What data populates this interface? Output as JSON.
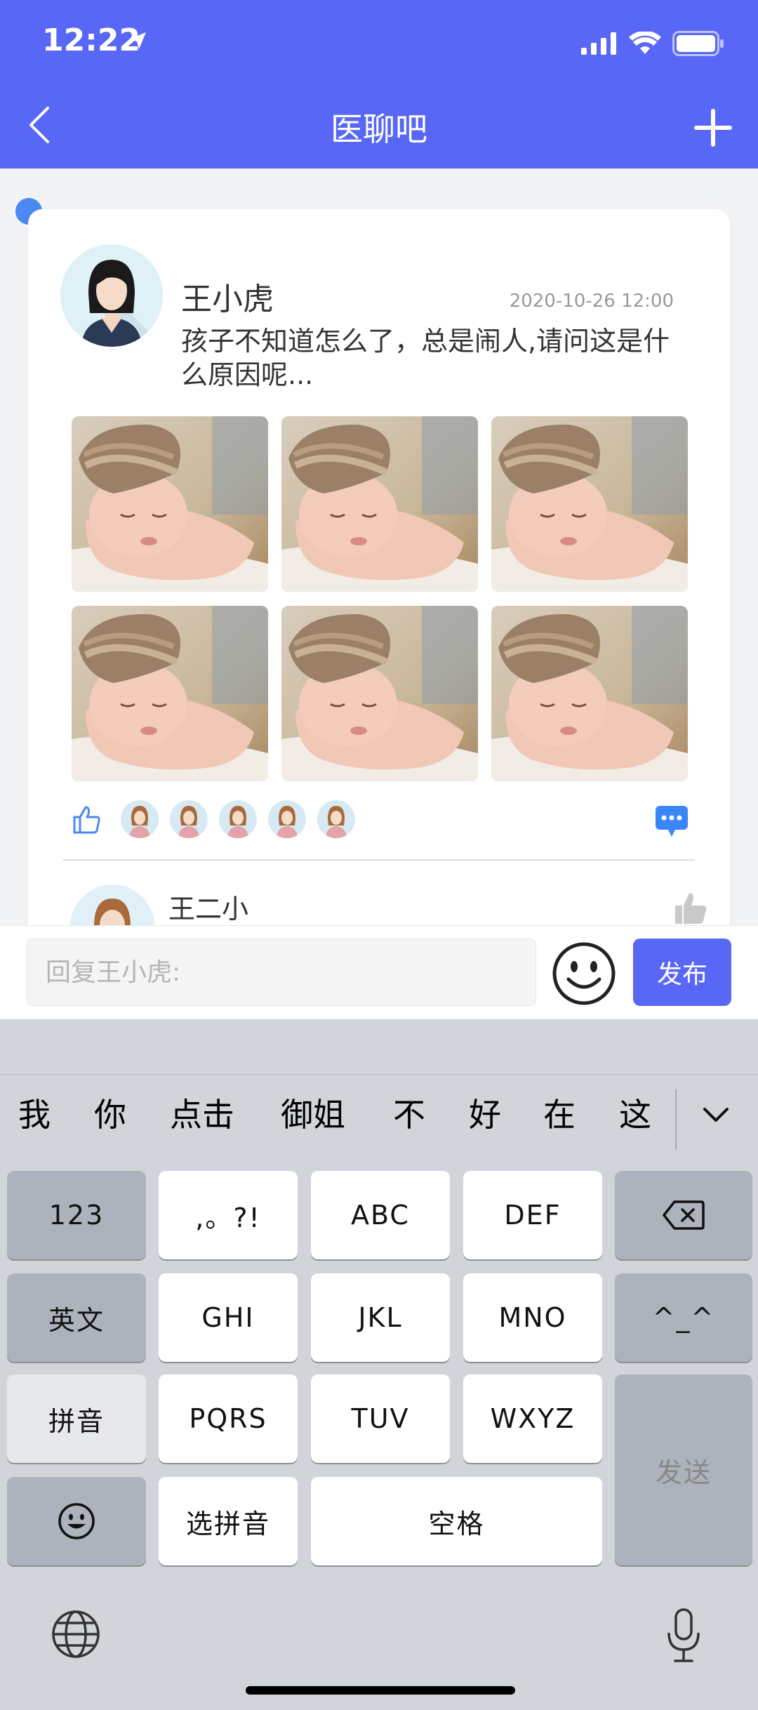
{
  "status": {
    "time": "12:22"
  },
  "nav": {
    "title": "医聊吧"
  },
  "post": {
    "author": "王小虎",
    "time": "2020-10-26 12:00",
    "content": "孩子不知道怎么了，总是闹人,请问这是什么原因呢...",
    "photos": [
      "sleeping-baby-photo",
      "sleeping-baby-photo",
      "sleeping-baby-photo",
      "sleeping-baby-photo",
      "sleeping-baby-photo",
      "sleeping-baby-photo"
    ],
    "likes_avatar_count": 5
  },
  "comment": {
    "author": "王二小"
  },
  "reply": {
    "placeholder": "回复王小虎:",
    "publish_label": "发布"
  },
  "keyboard": {
    "candidates": [
      "我",
      "你",
      "点击",
      "御姐",
      "不",
      "好",
      "在",
      "这"
    ],
    "keys": {
      "k123": "123",
      "punct": ",。?!",
      "abc": "ABC",
      "def": "DEF",
      "english": "英文",
      "ghi": "GHI",
      "jkl": "JKL",
      "mno": "MNO",
      "face": "^_^",
      "pinyin": "拼音",
      "pqrs": "PQRS",
      "tuv": "TUV",
      "wxyz": "WXYZ",
      "send": "发送",
      "select_pinyin": "选拼音",
      "space": "空格"
    }
  },
  "colors": {
    "accent": "#5867f5",
    "keyboard_bg": "#d1d4d9"
  }
}
